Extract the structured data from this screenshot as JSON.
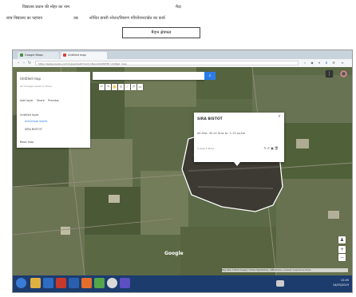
{
  "document": {
    "line1_left": "विद्यालय प्रधान की मोहर का नाम",
    "line1_right": "मैदा",
    "line2_left": "छात्र विद्यालय का पहचान",
    "line2_mid": "उम्र",
    "line2_right": "शोधित डायरी शोधन/विवरण परियोजना/खेत का कार्य",
    "boxed_label": "मैदान क्षेत्रफल"
  },
  "browser": {
    "tabs": [
      {
        "label": "Google Maps",
        "color": "#4a8f3c"
      },
      {
        "label": "Untitled map",
        "color": "#d9423b"
      }
    ],
    "url": "https://www.google.com/maps/d/edit?mid=1NqxA3kdP4F8t_Untitled_map",
    "url_icons": [
      "bookmark-icon",
      "menu-icon",
      "extension-icon"
    ]
  },
  "map_panel": {
    "title": "Untitled map",
    "subtitle": "All changes saved in Drive",
    "actions": [
      "Add layer",
      "Share",
      "Preview"
    ],
    "layer_title": "Untitled layer",
    "layer_style": "Individual styles",
    "feature": "SIRA BISTOT",
    "basemap": "Base map"
  },
  "popup": {
    "title": "SIRA BISTOT",
    "coordinates": "Alt.Dist. 30.41 Kms  Ar: 1.15 sq.km",
    "meta": "1 Area  2 Point"
  },
  "attribution": "Map data ©2019 Imagery ©2019 DigitalGlobe, CNES/Airbus, Landsat / Copernicus  Terms",
  "google": "Google",
  "tray": {
    "time": "12:45",
    "date": "14/03/2019"
  },
  "colors": {
    "taskbar": "#1c3c6e",
    "accent": "#2b7de9",
    "farm": "#5f6d4a"
  }
}
